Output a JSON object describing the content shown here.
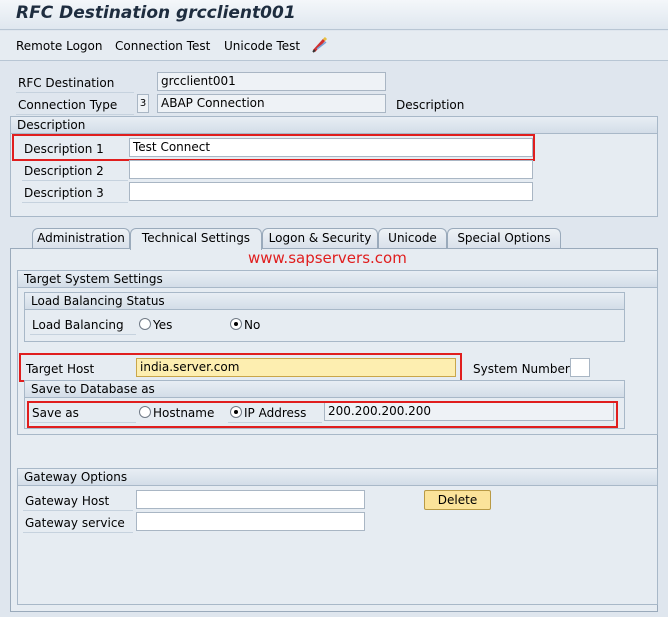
{
  "title": "RFC Destination grcclient001",
  "toolbar": {
    "remote_logon": "Remote Logon",
    "connection_test": "Connection Test",
    "unicode_test": "Unicode Test"
  },
  "header": {
    "rfc_destination_label": "RFC Destination",
    "rfc_destination_value": "grcclient001",
    "connection_type_label": "Connection Type",
    "connection_type_code": "3",
    "connection_type_value": "ABAP Connection",
    "description_label": "Description"
  },
  "description_group": {
    "title": "Description",
    "desc1_label": "Description 1",
    "desc1_value": "Test Connect",
    "desc2_label": "Description 2",
    "desc2_value": "",
    "desc3_label": "Description 3",
    "desc3_value": ""
  },
  "tabs": [
    {
      "label": "Administration"
    },
    {
      "label": "Technical Settings",
      "active": true
    },
    {
      "label": "Logon & Security"
    },
    {
      "label": "Unicode"
    },
    {
      "label": "Special Options"
    }
  ],
  "watermark": "www.sapservers.com",
  "target_system": {
    "title": "Target System Settings",
    "load_balancing_status_title": "Load Balancing Status",
    "load_balancing_label": "Load Balancing",
    "yes_label": "Yes",
    "no_label": "No",
    "load_balancing_selected": "No",
    "target_host_label": "Target Host",
    "target_host_value": "india.server.com",
    "system_number_label": "System Number",
    "system_number_value": "",
    "save_to_db_title": "Save to Database as",
    "save_as_label": "Save as",
    "hostname_label": "Hostname",
    "ip_address_label": "IP Address",
    "save_as_selected": "IP Address",
    "ip_value": "200.200.200.200"
  },
  "gateway": {
    "title": "Gateway Options",
    "host_label": "Gateway Host",
    "host_value": "",
    "service_label": "Gateway service",
    "service_value": "",
    "delete_label": "Delete"
  },
  "colors": {
    "highlight_red": "#e01e1e",
    "input_yellow": "#fdeeb0",
    "button_yellow": "#fbe39a",
    "background": "#dfe6ee"
  }
}
